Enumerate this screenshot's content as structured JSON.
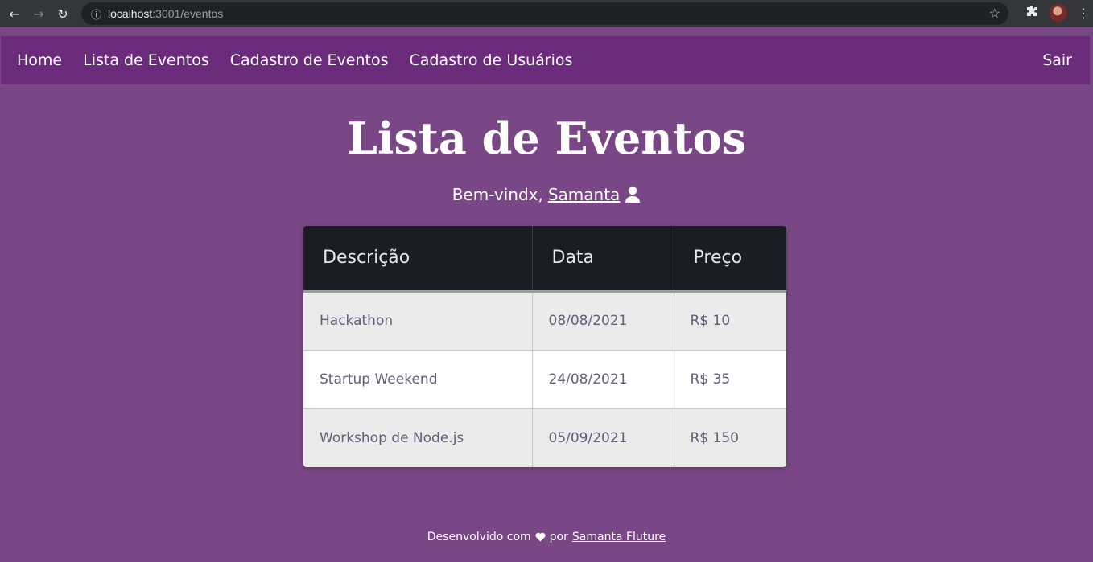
{
  "browser": {
    "url_host": "localhost",
    "url_path": ":3001/eventos"
  },
  "nav": {
    "items": [
      {
        "label": "Home"
      },
      {
        "label": "Lista de Eventos"
      },
      {
        "label": "Cadastro de Eventos"
      },
      {
        "label": "Cadastro de Usuários"
      }
    ],
    "logout_label": "Sair"
  },
  "main": {
    "title": "Lista de Eventos",
    "welcome_prefix": "Bem-vindx,",
    "user_name": "Samanta"
  },
  "table": {
    "headers": [
      "Descrição",
      "Data",
      "Preço"
    ],
    "rows": [
      {
        "descricao": "Hackathon",
        "data": "08/08/2021",
        "preco": "R$ 10"
      },
      {
        "descricao": "Startup Weekend",
        "data": "24/08/2021",
        "preco": "R$ 35"
      },
      {
        "descricao": "Workshop de Node.js",
        "data": "05/09/2021",
        "preco": "R$ 150"
      }
    ]
  },
  "footer": {
    "prefix": "Desenvolvido com",
    "middle": "por",
    "author": "Samanta Fluture"
  },
  "colors": {
    "background": "#7a4786",
    "navbar": "#6a2c7a",
    "table_header": "#1b1d24"
  }
}
